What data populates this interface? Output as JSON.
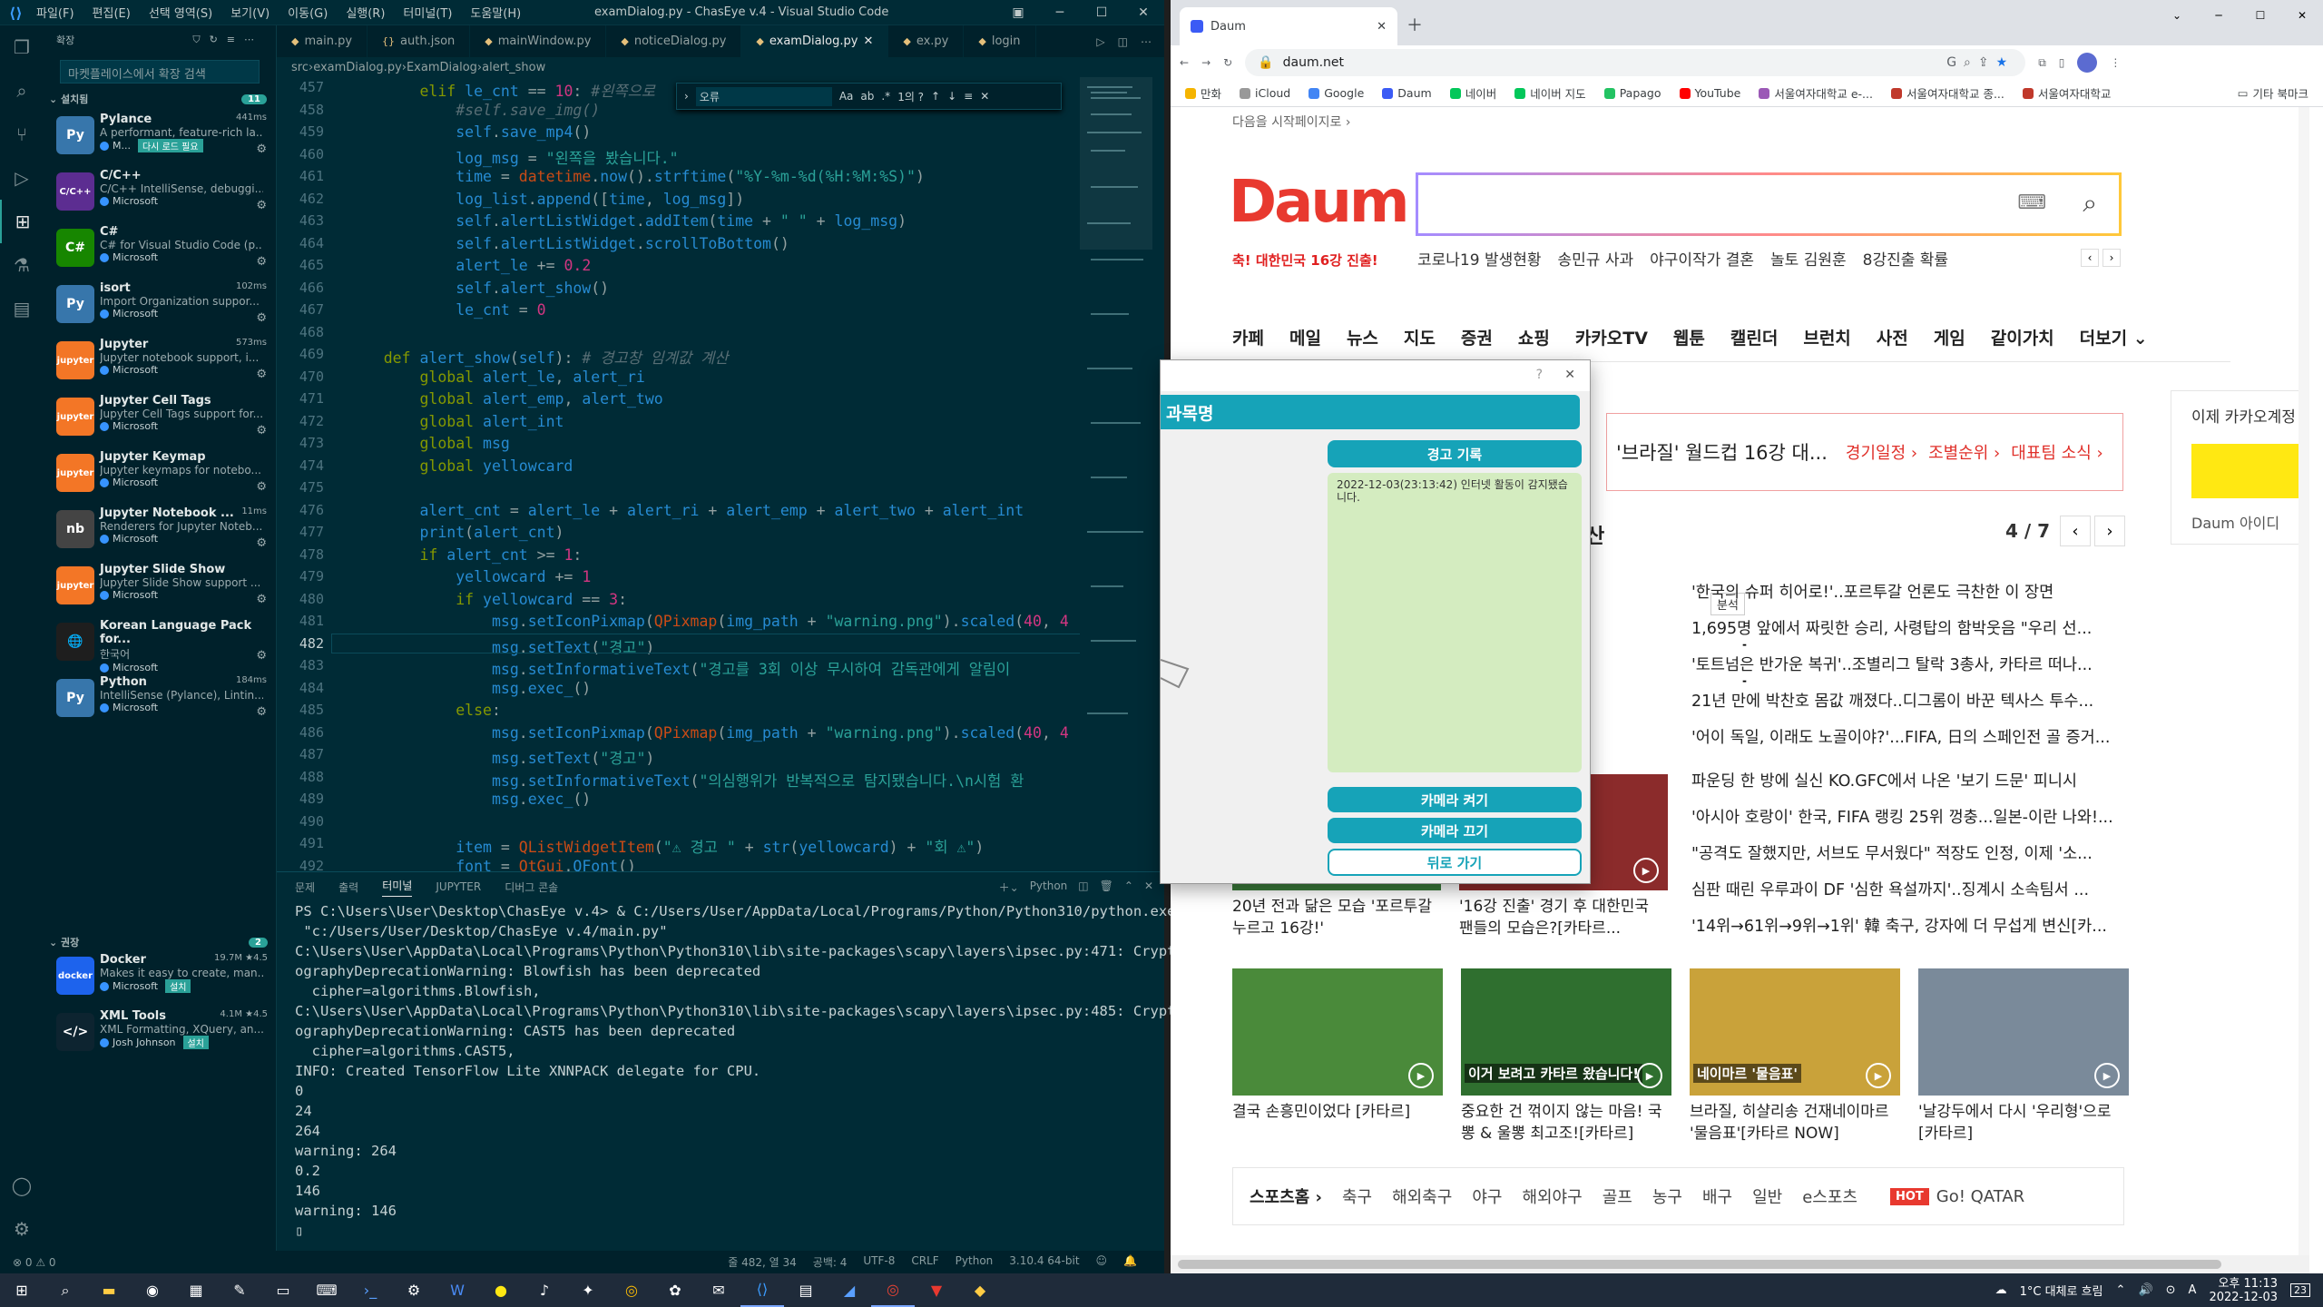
{
  "vscode": {
    "menu": [
      "파일(F)",
      "편집(E)",
      "선택 영역(S)",
      "보기(V)",
      "이동(G)",
      "실행(R)",
      "터미널(T)",
      "도움말(H)"
    ],
    "window_title": "examDialog.py - ChasEye v.4 - Visual Studio Code",
    "sidebar": {
      "header": "확장",
      "search_placeholder": "마켓플레이스에서 확장 검색",
      "installed_label": "설치됨",
      "installed_count": "11",
      "recommended_label": "권장",
      "recommended_count": "2",
      "extensions": [
        {
          "name": "Pylance",
          "desc": "A performant, feature-rich la...",
          "publisher": "M...",
          "meta": "441ms",
          "extra": "다시 로드 필요",
          "logo": "Py",
          "color": "#3776ab"
        },
        {
          "name": "C/C++",
          "desc": "C/C++ IntelliSense, debuggi...",
          "publisher": "Microsoft",
          "meta": "",
          "logo": "C/C++",
          "color": "#5c2d91"
        },
        {
          "name": "C#",
          "desc": "C# for Visual Studio Code (p...",
          "publisher": "Microsoft",
          "meta": "",
          "logo": "C#",
          "color": "#178600"
        },
        {
          "name": "isort",
          "desc": "Import Organization suppor...",
          "publisher": "Microsoft",
          "meta": "102ms",
          "logo": "Py",
          "color": "#3776ab"
        },
        {
          "name": "Jupyter",
          "desc": "Jupyter notebook support, i...",
          "publisher": "Microsoft",
          "meta": "573ms",
          "logo": "jupyter",
          "color": "#f37626"
        },
        {
          "name": "Jupyter Cell Tags",
          "desc": "Jupyter Cell Tags support for...",
          "publisher": "Microsoft",
          "meta": "",
          "logo": "jupyter",
          "color": "#f37626"
        },
        {
          "name": "Jupyter Keymap",
          "desc": "Jupyter keymaps for notebo...",
          "publisher": "Microsoft",
          "meta": "",
          "logo": "jupyter",
          "color": "#f37626"
        },
        {
          "name": "Jupyter Notebook ...",
          "desc": "Renderers for Jupyter Noteb...",
          "publisher": "Microsoft",
          "meta": "11ms",
          "logo": "nb",
          "color": "#444"
        },
        {
          "name": "Jupyter Slide Show",
          "desc": "Jupyter Slide Show support ...",
          "publisher": "Microsoft",
          "meta": "",
          "logo": "jupyter",
          "color": "#f37626"
        },
        {
          "name": "Korean Language Pack for...",
          "desc": "한국어",
          "publisher": "Microsoft",
          "meta": "",
          "logo": "🌐",
          "color": "#1e1e1e"
        },
        {
          "name": "Python",
          "desc": "IntelliSense (Pylance), Lintin...",
          "publisher": "Microsoft",
          "meta": "184ms",
          "logo": "Py",
          "color": "#3776ab"
        }
      ],
      "recommended": [
        {
          "name": "Docker",
          "desc": "Makes it easy to create, man...",
          "publisher": "Microsoft",
          "meta": "19.7M ★4.5",
          "logo": "docker",
          "color": "#1d63ed"
        },
        {
          "name": "XML Tools",
          "desc": "XML Formatting, XQuery, an...",
          "publisher": "Josh Johnson",
          "meta": "4.1M ★4.5",
          "logo": "</>",
          "color": "#0d2430"
        }
      ],
      "install_label": "설치"
    },
    "tabs": [
      "main.py",
      "auth.json",
      "mainWindow.py",
      "noticeDialog.py",
      "examDialog.py",
      "ex.py",
      "login"
    ],
    "breadcrumb": [
      "src",
      "examDialog.py",
      "ExamDialog",
      "alert_show"
    ],
    "find": {
      "value": "오류",
      "result": "1의 ?",
      "opts": [
        "Aa",
        "ab",
        ".*"
      ]
    },
    "code_lines": [
      {
        "n": "457",
        "html": "        <span class='k'>elif</span> <span class='v'>le_cnt</span> == <span class='n'>10</span>: <span class='c'>#왼쪽으로</span>"
      },
      {
        "n": "458",
        "html": "            <span class='c'>#self.save_img()</span>"
      },
      {
        "n": "459",
        "html": "            <span class='v'>self</span>.<span class='f'>save_mp4</span>()"
      },
      {
        "n": "460",
        "html": "            <span class='v'>log_msg</span> = <span class='s'>\"왼쪽을 봤습니다.\"</span>"
      },
      {
        "n": "461",
        "html": "            <span class='v'>time</span> = <span class='cls'>datetime</span>.<span class='f'>now</span>().<span class='f'>strftime</span>(<span class='s'>\"%Y-%m-%d(%H:%M:%S)\"</span>)"
      },
      {
        "n": "462",
        "html": "            <span class='v'>log_list</span>.<span class='f'>append</span>([<span class='v'>time</span>, <span class='v'>log_msg</span>])"
      },
      {
        "n": "463",
        "html": "            <span class='v'>self</span>.<span class='v'>alertListWidget</span>.<span class='f'>addItem</span>(<span class='v'>time</span> + <span class='s'>\" \"</span> + <span class='v'>log_msg</span>)"
      },
      {
        "n": "464",
        "html": "            <span class='v'>self</span>.<span class='v'>alertListWidget</span>.<span class='f'>scrollToBottom</span>()"
      },
      {
        "n": "465",
        "html": "            <span class='v'>alert_le</span> += <span class='n'>0.2</span>"
      },
      {
        "n": "466",
        "html": "            <span class='v'>self</span>.<span class='f'>alert_show</span>()"
      },
      {
        "n": "467",
        "html": "            <span class='v'>le_cnt</span> = <span class='n'>0</span>"
      },
      {
        "n": "468",
        "html": ""
      },
      {
        "n": "469",
        "html": "    <span class='k'>def</span> <span class='f'>alert_show</span>(<span class='v'>self</span>): <span class='c'># 경고창 임계값 계산</span>"
      },
      {
        "n": "470",
        "html": "        <span class='k'>global</span> <span class='v'>alert_le</span>, <span class='v'>alert_ri</span>"
      },
      {
        "n": "471",
        "html": "        <span class='k'>global</span> <span class='v'>alert_emp</span>, <span class='v'>alert_two</span>"
      },
      {
        "n": "472",
        "html": "        <span class='k'>global</span> <span class='v'>alert_int</span>"
      },
      {
        "n": "473",
        "html": "        <span class='k'>global</span> <span class='v'>msg</span>"
      },
      {
        "n": "474",
        "html": "        <span class='k'>global</span> <span class='v'>yellowcard</span>"
      },
      {
        "n": "475",
        "html": ""
      },
      {
        "n": "476",
        "html": "        <span class='v'>alert_cnt</span> = <span class='v'>alert_le</span> + <span class='v'>alert_ri</span> + <span class='v'>alert_emp</span> + <span class='v'>alert_two</span> + <span class='v'>alert_int</span>"
      },
      {
        "n": "477",
        "html": "        <span class='f'>print</span>(<span class='v'>alert_cnt</span>)"
      },
      {
        "n": "478",
        "html": "        <span class='k'>if</span> <span class='v'>alert_cnt</span> >= <span class='n'>1</span>:"
      },
      {
        "n": "479",
        "html": "            <span class='v'>yellowcard</span> += <span class='n'>1</span>"
      },
      {
        "n": "480",
        "html": "            <span class='k'>if</span> <span class='v'>yellowcard</span> == <span class='n'>3</span>:"
      },
      {
        "n": "481",
        "html": "                <span class='v'>msg</span>.<span class='f'>setIconPixmap</span>(<span class='cls'>QPixmap</span>(<span class='v'>img_path</span> + <span class='s'>\"warning.png\"</span>).<span class='f'>scaled</span>(<span class='n'>40</span>, <span class='n'>4</span>"
      },
      {
        "n": "482",
        "html": "                <span class='v'>msg</span>.<span class='f'>setText</span>(<span class='s'>\"경고\"</span>)"
      },
      {
        "n": "483",
        "html": "                <span class='v'>msg</span>.<span class='f'>setInformativeText</span>(<span class='s'>\"경고를 3회 이상 무시하여 감독관에게 알림이 </span>"
      },
      {
        "n": "484",
        "html": "                <span class='v'>msg</span>.<span class='f'>exec_</span>()"
      },
      {
        "n": "485",
        "html": "            <span class='k'>else</span>:"
      },
      {
        "n": "486",
        "html": "                <span class='v'>msg</span>.<span class='f'>setIconPixmap</span>(<span class='cls'>QPixmap</span>(<span class='v'>img_path</span> + <span class='s'>\"warning.png\"</span>).<span class='f'>scaled</span>(<span class='n'>40</span>, <span class='n'>4</span>"
      },
      {
        "n": "487",
        "html": "                <span class='v'>msg</span>.<span class='f'>setText</span>(<span class='s'>\"경고\"</span>)"
      },
      {
        "n": "488",
        "html": "                <span class='v'>msg</span>.<span class='f'>setInformativeText</span>(<span class='s'>\"의심행위가 반복적으로 탐지됐습니다.\\n시험 환</span>"
      },
      {
        "n": "489",
        "html": "                <span class='v'>msg</span>.<span class='f'>exec_</span>()"
      },
      {
        "n": "490",
        "html": ""
      },
      {
        "n": "491",
        "html": "            <span class='v'>item</span> = <span class='cls'>QListWidgetItem</span>(<span class='s'>\"⚠ 경고 \"</span> + <span class='f'>str</span>(<span class='v'>yellowcard</span>) + <span class='s'>\"회 ⚠\"</span>)"
      },
      {
        "n": "492",
        "html": "            <span class='v'>font</span> = <span class='cls'>QtGui</span>.<span class='f'>QFont</span>()"
      }
    ],
    "panel_tabs": [
      "문제",
      "출력",
      "터미널",
      "JUPYTER",
      "디버그 콘솔"
    ],
    "panel_shell": "Python",
    "terminal": [
      "PS C:\\Users\\User\\Desktop\\ChasEye v.4> & C:/Users/User/AppData/Local/Programs/Python/Python310/python.exe",
      " \"c:/Users/User/Desktop/ChasEye v.4/main.py\"",
      "C:\\Users\\User\\AppData\\Local\\Programs\\Python\\Python310\\lib\\site-packages\\scapy\\layers\\ipsec.py:471: Crypt",
      "ographyDeprecationWarning: Blowfish has been deprecated",
      "  cipher=algorithms.Blowfish,",
      "C:\\Users\\User\\AppData\\Local\\Programs\\Python\\Python310\\lib\\site-packages\\scapy\\layers\\ipsec.py:485: Crypt",
      "ographyDeprecationWarning: CAST5 has been deprecated",
      "  cipher=algorithms.CAST5,",
      "INFO: Created TensorFlow Lite XNNPACK delegate for CPU.",
      "0",
      "24",
      "264",
      "warning: 264",
      "0.2",
      "146",
      "warning: 146",
      "▯"
    ],
    "status": {
      "errors": "⊗ 0 ⚠ 0",
      "pos": "줄 482, 열 34",
      "spaces": "공백: 4",
      "enc": "UTF-8",
      "eol": "CRLF",
      "lang": "Python",
      "ver": "3.10.4 64-bit"
    }
  },
  "chrome": {
    "tab_title": "Daum",
    "url": "daum.net",
    "bookmarks": [
      {
        "label": "만화",
        "color": "#f5b400"
      },
      {
        "label": "iCloud",
        "color": "#999"
      },
      {
        "label": "Google",
        "color": "#4285f4"
      },
      {
        "label": "Daum",
        "color": "#3b5bf5"
      },
      {
        "label": "네이버",
        "color": "#03c75a"
      },
      {
        "label": "네이버 지도",
        "color": "#03c75a"
      },
      {
        "label": "Papago",
        "color": "#23c363"
      },
      {
        "label": "YouTube",
        "color": "#ff0000"
      },
      {
        "label": "서울여자대학교 e-...",
        "color": "#9b59b6"
      },
      {
        "label": "서울여자대학교 종...",
        "color": "#c0392b"
      },
      {
        "label": "서울여자대학교",
        "color": "#c0392b"
      }
    ],
    "bookmarks_more": "기타 북마크"
  },
  "daum": {
    "start_link": "다음을 시작페이지로 ›",
    "logo": "Daum",
    "logo_caption": "축! 대한민국 16강 진출!",
    "trends": [
      "코로나19 발생현황",
      "송민규 사과",
      "야구이작가 결혼",
      "놀토 김원훈",
      "8강진출 확률"
    ],
    "nav": [
      "카페",
      "메일",
      "뉴스",
      "지도",
      "증권",
      "쇼핑",
      "카카오TV",
      "웹툰",
      "캘린더",
      "브런치",
      "사전",
      "게임",
      "같이가치",
      "더보기 ⌄"
    ],
    "banner": {
      "title": "'브라질' 월드컵 16강 대...",
      "links": [
        "경기일정 ›",
        "조별순위 ›",
        "대표팀 소식 ›"
      ]
    },
    "section_title": "산",
    "page": "4 / 7",
    "tag": "분석",
    "headlines": [
      "'한국의 슈퍼 히어로!'..포르투갈 언론도 극찬한 이 장면",
      "1,695명 앞에서 짜릿한 승리, 사령탑의 함박웃음 \"우리 선...",
      "'토트넘은 반가운 복귀'..조별리그 탈락 3총사, 카타르 떠나...",
      "21년 만에 박찬호 몸값 깨졌다..디그롬이 바꾼 텍사스 투수...",
      "'어이 독일, 이래도 노골이야?'...FIFA, 日의 스페인전 골 증거...",
      "파운딩 한 방에 실신 KO.GFC에서 나온 '보기 드문' 피니시",
      "'아시아 호랑이' 한국, FIFA 랭킹 25위 껑충...일본-이란 나와!...",
      "\"공격도 잘했지만, 서브도 무서웠다\" 적장도 인정, 이제 '소...",
      "심판 때린 우루과이 DF '심한 욕설까지'..징계시 소속팀서 ...",
      "'14위→61위→9위→1위' 韓 축구, 강자에 더 무섭게 변신[카..."
    ],
    "cards_row1": [
      {
        "caption": "20년 전과 닮은 모습 '포르투갈 누르고 16강!'",
        "color": "#3a7a3a"
      },
      {
        "caption": "'16강 진출' 경기 후 대한민국 팬들의 모습은?[카타르...",
        "color": "#8b2b2b"
      }
    ],
    "cards_row2": [
      {
        "caption": "결국 손흥민이었다 [카타르]",
        "color": "#4a8a3a"
      },
      {
        "caption": "중요한 건 꺾이지 않는 마음! 국뽕 & 울뽕 최고조![카타르]",
        "color": "#2f6f2f",
        "overlay": "이거 보려고 카타르 왔습니다!"
      },
      {
        "caption": "브라질, 히샬리송 건재네이마르 '물음표'[카타르 NOW]",
        "color": "#c9a23a",
        "overlay": "네이마르 '물음표'"
      },
      {
        "caption": "'날강두에서 다시 '우리형'으로 [카타르]",
        "color": "#7a8a9a"
      }
    ],
    "sports_nav": [
      "스포츠홈 ›",
      "축구",
      "해외축구",
      "야구",
      "해외야구",
      "골프",
      "농구",
      "배구",
      "일반",
      "e스포츠"
    ],
    "hot_label": "HOT",
    "hot_text": "Go! QATAR",
    "right_ad": "이제 카카오계정",
    "right_id": "Daum 아이디"
  },
  "dialog": {
    "help": "?",
    "close": "✕",
    "subject_label": "과목명",
    "log_title": "경고 기록",
    "log_entry": "2022-12-03(23:13:42) 인터넷 활동이 감지됐습니다.",
    "btn_cam_on": "카메라 켜기",
    "btn_cam_off": "카메라 끄기",
    "btn_back": "뒤로 가기"
  },
  "taskbar": {
    "weather": "1°C  대체로 흐림",
    "time": "오후 11:13",
    "date": "2022-12-03",
    "ime": "A",
    "notif": "23"
  }
}
